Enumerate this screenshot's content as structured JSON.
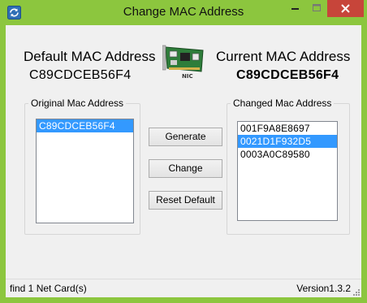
{
  "window": {
    "title": "Change MAC Address",
    "accent_color": "#8cc63e",
    "close_color": "#c7453a"
  },
  "titlebar_icons": [
    "refresh-app-icon",
    "minimize-icon",
    "maximize-icon",
    "close-icon"
  ],
  "header": {
    "default_label": "Default MAC Address",
    "default_value": "C89CDCEB56F4",
    "current_label": "Current MAC Address",
    "current_value": "C89CDCEB56F4",
    "nic_icon_text": "NIC"
  },
  "original_group": {
    "legend": "Original Mac Address",
    "items": [
      {
        "value": "C89CDCEB56F4",
        "selected": true
      }
    ]
  },
  "changed_group": {
    "legend": "Changed Mac Address",
    "items": [
      {
        "value": "001F9A8E8697",
        "selected": false
      },
      {
        "value": "0021D1F932D5",
        "selected": true
      },
      {
        "value": "0003A0C89580",
        "selected": false
      }
    ]
  },
  "buttons": {
    "generate": "Generate",
    "change": "Change",
    "reset": "Reset Default"
  },
  "status": {
    "left": "find 1 Net Card(s)",
    "right": "Version1.3.2"
  }
}
